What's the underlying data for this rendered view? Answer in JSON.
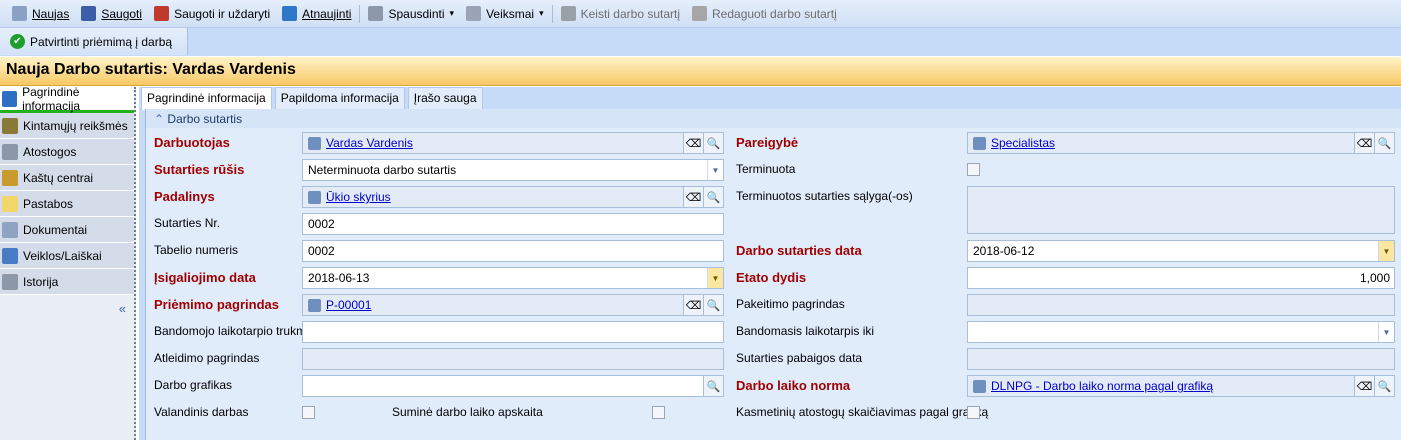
{
  "toolbar": {
    "items": [
      {
        "label": "Naujas",
        "icon": "new-document-icon",
        "color": "#8aa1c4",
        "enabled": true,
        "underline": true
      },
      {
        "label": "Saugoti",
        "icon": "save-icon",
        "color": "#3c5da8",
        "enabled": true,
        "underline": true
      },
      {
        "label": "Saugoti ir uždaryti",
        "icon": "save-close-icon",
        "color": "#c0392b",
        "enabled": true,
        "underline": false
      },
      {
        "label": "Atnaujinti",
        "icon": "refresh-icon",
        "color": "#2f77c9",
        "enabled": true,
        "underline": true
      },
      {
        "label": "Spausdinti",
        "icon": "print-icon",
        "color": "#8d98a8",
        "enabled": true,
        "dropdown": true
      },
      {
        "label": "Veiksmai",
        "icon": "gear-icon",
        "color": "#9aa4b5",
        "enabled": true,
        "dropdown": true
      },
      {
        "label": "Keisti darbo sutartį",
        "icon": "edit-contract-icon",
        "color": "#9aa0a8",
        "enabled": false
      },
      {
        "label": "Redaguoti darbo sutartį",
        "icon": "edit-icon",
        "color": "#a6a6a6",
        "enabled": false
      }
    ],
    "confirm_label": "Patvirtinti priėmimą į darbą"
  },
  "title": "Nauja Darbo sutartis: Vardas Vardenis",
  "sidebar": {
    "items": [
      {
        "label": "Pagrindinė informacija",
        "icon": "database-icon",
        "color": "#2d6fc2"
      },
      {
        "label": "Kintamųjų reikšmės",
        "icon": "book-icon",
        "color": "#8a7a3a"
      },
      {
        "label": "Atostogos",
        "icon": "palm-icon",
        "color": "#8c98a8"
      },
      {
        "label": "Kaštų centrai",
        "icon": "money-bag-icon",
        "color": "#c99a2e"
      },
      {
        "label": "Pastabos",
        "icon": "note-icon",
        "color": "#f1d76a"
      },
      {
        "label": "Dokumentai",
        "icon": "documents-icon",
        "color": "#8ea4c2"
      },
      {
        "label": "Veiklos/Laiškai",
        "icon": "tasks-icon",
        "color": "#4a7cc6"
      },
      {
        "label": "Istorija",
        "icon": "history-icon",
        "color": "#8c98a8"
      }
    ],
    "collapse": "«"
  },
  "tabs": [
    "Pagrindinė informacija",
    "Papildoma informacija",
    "Įrašo sauga"
  ],
  "section": "Darbo sutartis",
  "left": [
    {
      "label": "Darbuotojas",
      "req": true,
      "type": "link",
      "value": "Vardas Vardenis",
      "icon": "person-card-icon"
    },
    {
      "label": "Sutarties rūšis",
      "req": true,
      "type": "combo",
      "value": "Neterminuota darbo sutartis"
    },
    {
      "label": "Padalinys",
      "req": true,
      "type": "link",
      "value": "Ūkio skyrius",
      "icon": "building-icon"
    },
    {
      "label": "Sutarties Nr.",
      "type": "text",
      "value": "0002"
    },
    {
      "label": "Tabelio numeris",
      "type": "text",
      "value": "0002"
    },
    {
      "label": "Įsigaliojimo data",
      "req": true,
      "type": "date",
      "value": "2018-06-13"
    },
    {
      "label": "Priėmimo pagrindas",
      "req": true,
      "type": "link",
      "value": "P-00001",
      "icon": "graduation-cap-icon"
    },
    {
      "label": "Bandomojo laikotarpio trukmė",
      "type": "text",
      "value": ""
    },
    {
      "label": "Atleidimo pagrindas",
      "type": "ro",
      "value": ""
    },
    {
      "label": "Darbo grafikas",
      "type": "lookup",
      "value": ""
    },
    {
      "label": "Valandinis darbas",
      "type": "check",
      "checked": false
    }
  ],
  "extra": {
    "label": "Suminė darbo laiko apskaita",
    "checked": false
  },
  "right": [
    {
      "label": "Pareigybė",
      "req": true,
      "type": "link",
      "value": "Specialistas",
      "icon": "puzzle-icon"
    },
    {
      "label": "Terminuota",
      "type": "check",
      "checked": false
    },
    {
      "label": "Terminuotos sutarties sąlyga(-os)",
      "type": "area",
      "value": ""
    },
    null,
    {
      "label": "Darbo sutarties data",
      "req": true,
      "type": "date",
      "value": "2018-06-12"
    },
    {
      "label": "Etato dydis",
      "req": true,
      "type": "num",
      "value": "1,000"
    },
    {
      "label": "Pakeitimo pagrindas",
      "type": "ro",
      "value": ""
    },
    {
      "label": "Bandomasis laikotarpis iki",
      "type": "combo",
      "value": ""
    },
    {
      "label": "Sutarties pabaigos data",
      "type": "ro",
      "value": ""
    },
    {
      "label": "Darbo laiko norma",
      "req": true,
      "type": "link",
      "value": "DLNPG - Darbo laiko norma pagal grafiką",
      "icon": "calendar-table-icon"
    },
    {
      "label": "Kasmetinių atostogų skaičiavimas pagal grafiką",
      "type": "check",
      "checked": false
    }
  ]
}
